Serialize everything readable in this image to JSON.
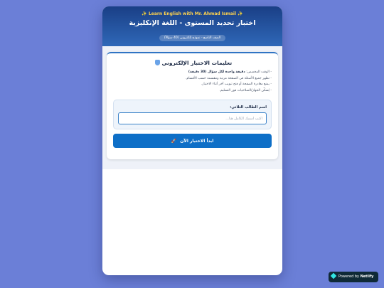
{
  "header": {
    "brand": "✨ Learn English with Mr. Ahmad Ismail ✨",
    "title": "اختبار تحديد المستوى - اللغة الإنكليزية",
    "subtitle": "الصف التاسع - نموذج إلكتروني (40 سؤالاً)"
  },
  "instructions": {
    "title": "تعليمات الاختبار الإلكتروني",
    "icon": "shield-icon",
    "rules": [
      {
        "prefix": "- الوقت المخصص: ",
        "bold": "دقيقة واحدة لكل سؤال (30 دقيقة)",
        "suffix": ""
      },
      {
        "prefix": "- تظهر جميع الأسئلة في الصفحة مرتبة ومقسمة حسب الأقسام.",
        "bold": "",
        "suffix": ""
      },
      {
        "prefix": "- يمنع مغادرة الصفحة أو فتح تبويب آخر أثناء الاختبار.",
        "bold": "",
        "suffix": ""
      },
      {
        "prefix": "- يُسكّن الجهاز/الصلاحيات فور التسليم.",
        "bold": "",
        "suffix": ""
      }
    ]
  },
  "form": {
    "name_label": "اسم الطالب الثلاثي:",
    "name_placeholder": "اكتب اسمك الكامل هنا...",
    "name_value": "",
    "start_label": "ابدأ الاختبار الآن",
    "start_icon": "🚀"
  },
  "badge": {
    "prefix": "Powered by ",
    "brand": "Netlify"
  },
  "colors": {
    "background": "#6b7fd7",
    "header_top": "#1a3f86",
    "header_bottom": "#2f68b8",
    "brand_gold": "#ffd34d",
    "button": "#0e6fc7"
  }
}
